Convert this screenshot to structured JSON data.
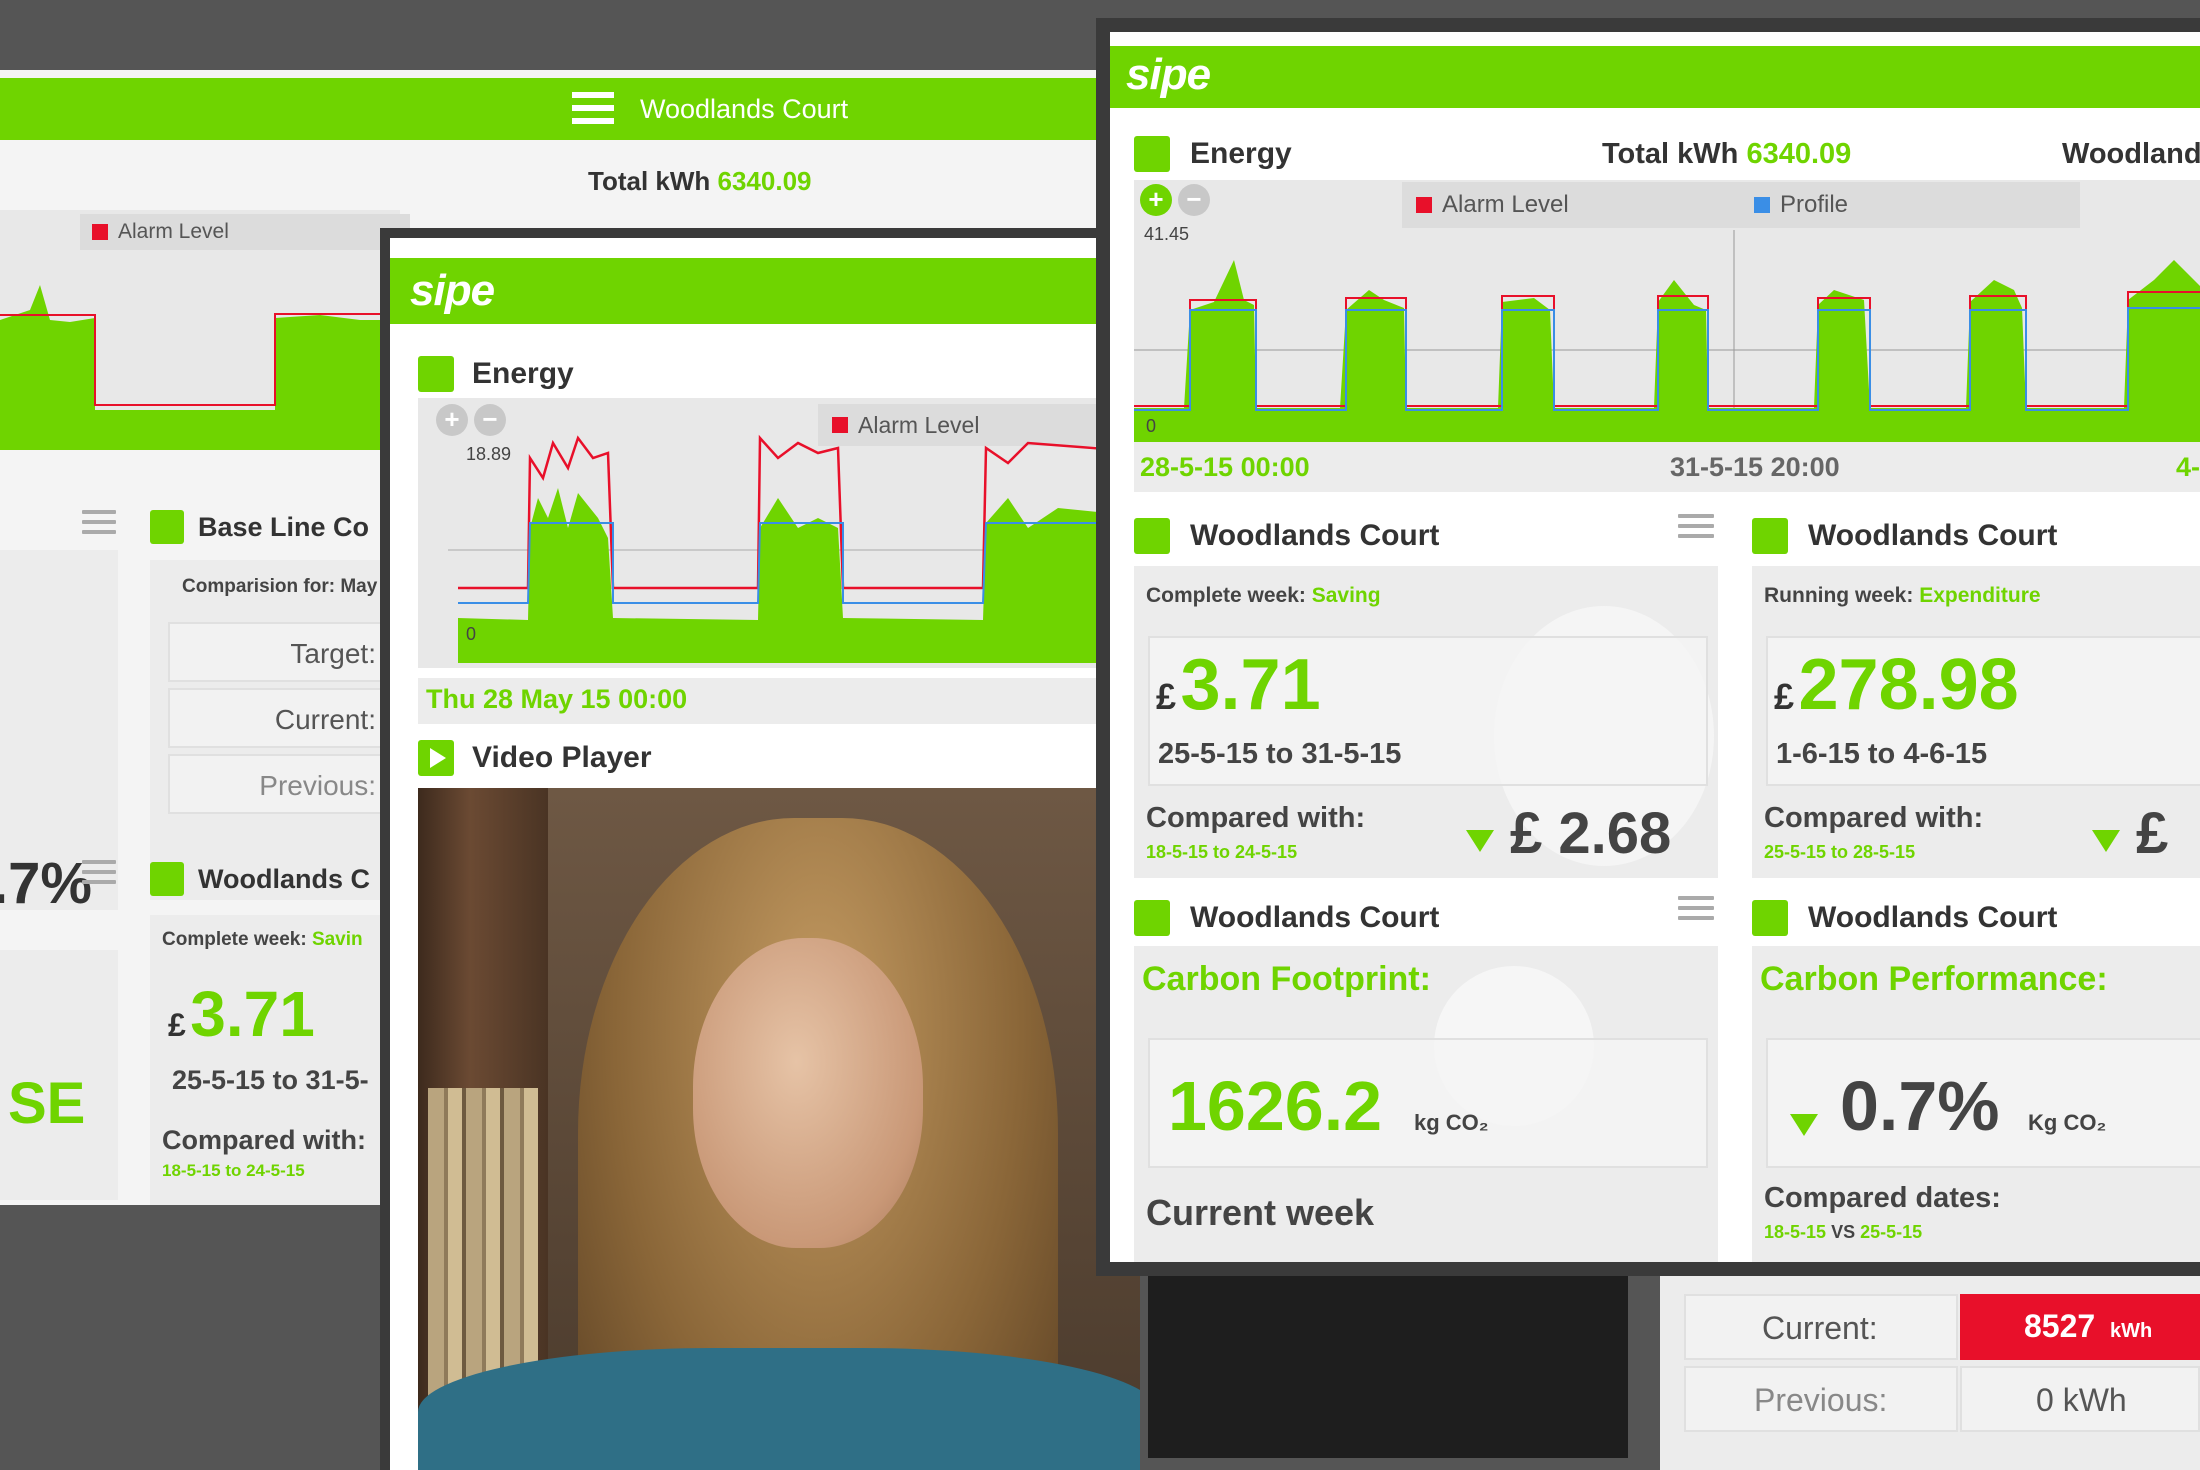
{
  "colors": {
    "accent": "#6fd400",
    "alarm": "#e8102a",
    "profile": "#3a8ee6",
    "background": "#555555"
  },
  "back_left": {
    "header_title": "Woodlands Court",
    "total_label": "Total kWh",
    "total_value": "6340.09",
    "alarm_legend": "Alarm Level",
    "baseline_title": "Base Line Co",
    "comparison_for": "Comparision for: May",
    "target_label": "Target:",
    "current_label": "Current:",
    "previous_label": "Previous:",
    "pct_fragment": ".7%",
    "se_fragment": "SE",
    "woodlands_title": "Woodlands C",
    "complete_week_label": "Complete week:",
    "complete_week_value": "Savin",
    "currency": "£",
    "amount": "3.71",
    "date_range": "25-5-15 to 31-5-",
    "compared_with": "Compared with:",
    "compared_dates": "18-5-15 to 24-5-15"
  },
  "middle": {
    "logo": "sipe",
    "energy_title": "Energy",
    "alarm_legend": "Alarm Level",
    "y_max": "18.89",
    "y_min": "0",
    "date_label": "Thu 28 May 15 00:00",
    "video_title": "Video Player"
  },
  "right_bottom": {
    "current_label": "Current:",
    "current_value": "8527",
    "current_unit": "kWh",
    "previous_label": "Previous:",
    "previous_value": "0 kWh"
  },
  "front": {
    "logo": "sipe",
    "energy_title": "Energy",
    "total_label": "Total kWh",
    "total_value": "6340.09",
    "site_fragment": "Woodland",
    "alarm_legend": "Alarm Level",
    "profile_legend": "Profile",
    "y_max": "41.45",
    "y_min": "0",
    "x_start": "28-5-15 00:00",
    "x_mid": "31-5-15 20:00",
    "x_end": "4-",
    "w1": {
      "title": "Woodlands Court",
      "period_label": "Complete week:",
      "period_value": "Saving",
      "currency": "£",
      "amount": "3.71",
      "date_range": "25-5-15 to 31-5-15",
      "compared_with": "Compared with:",
      "compared_dates": "18-5-15 to 24-5-15",
      "compared_amount": "£ 2.68"
    },
    "w2": {
      "title": "Woodlands Court",
      "period_label": "Running week:",
      "period_value": "Expenditure",
      "currency": "£",
      "amount": "278.98",
      "date_range": "1-6-15 to 4-6-15",
      "compared_with": "Compared with:",
      "compared_dates": "25-5-15 to 28-5-15",
      "compared_amount": "£"
    },
    "w3": {
      "title": "Woodlands Court",
      "heading": "Carbon Footprint:",
      "value": "1626.2",
      "unit": "kg CO₂",
      "footer": "Current week"
    },
    "w4": {
      "title": "Woodlands Court",
      "heading": "Carbon Performance:",
      "value": "0.7%",
      "unit": "Kg CO₂",
      "compared_label": "Compared dates:",
      "date_a": "18-5-15",
      "vs": "VS",
      "date_b": "25-5-15"
    }
  }
}
